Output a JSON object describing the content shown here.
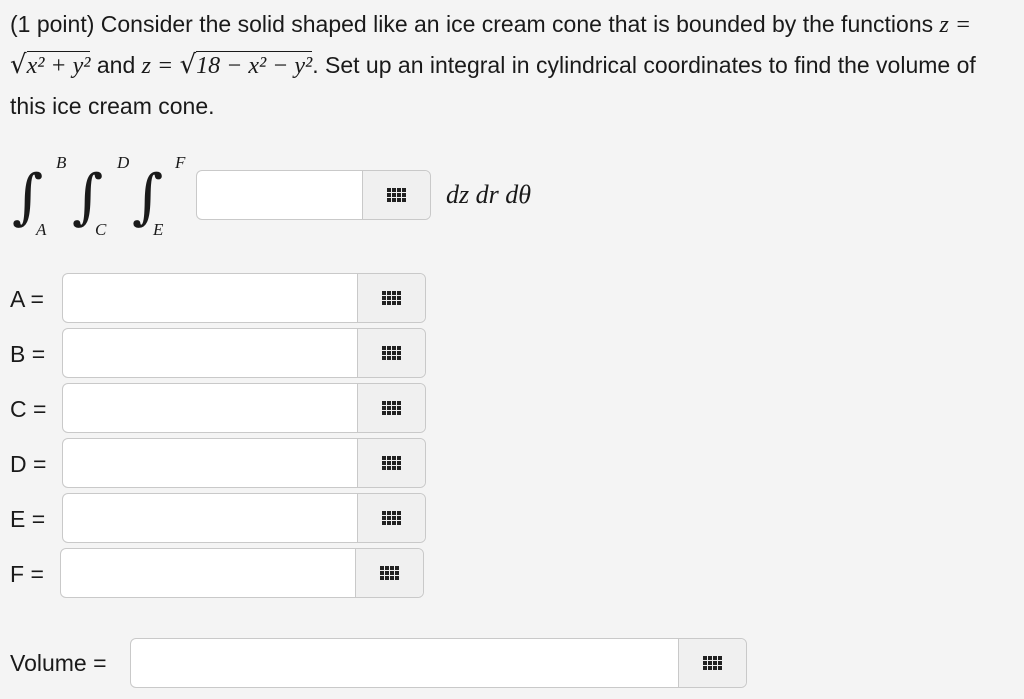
{
  "problem": {
    "prefix": "(1 point) Consider the solid shaped like an ice cream cone that is bounded by the functions",
    "z_eq_1": "z =",
    "radicand_1": "x² + y²",
    "and_text": "and",
    "z_eq_2": "z =",
    "radicand_2": "18 − x² − y²",
    "suffix": ". Set up an integral in cylindrical coordinates to find the volume of this ice cream cone."
  },
  "integral": {
    "symbol": "∫",
    "limits": [
      {
        "upper": "B",
        "lower": "A"
      },
      {
        "upper": "D",
        "lower": "C"
      },
      {
        "upper": "F",
        "lower": "E"
      }
    ],
    "differential": "dz dr dθ",
    "integrand_value": ""
  },
  "fields": [
    {
      "label": "A =",
      "value": ""
    },
    {
      "label": "B =",
      "value": ""
    },
    {
      "label": "C =",
      "value": ""
    },
    {
      "label": "D =",
      "value": ""
    },
    {
      "label": "E =",
      "value": ""
    },
    {
      "label": "F =",
      "value": ""
    }
  ],
  "volume": {
    "label": "Volume =",
    "value": ""
  },
  "keypad_icon": "keypad-icon"
}
